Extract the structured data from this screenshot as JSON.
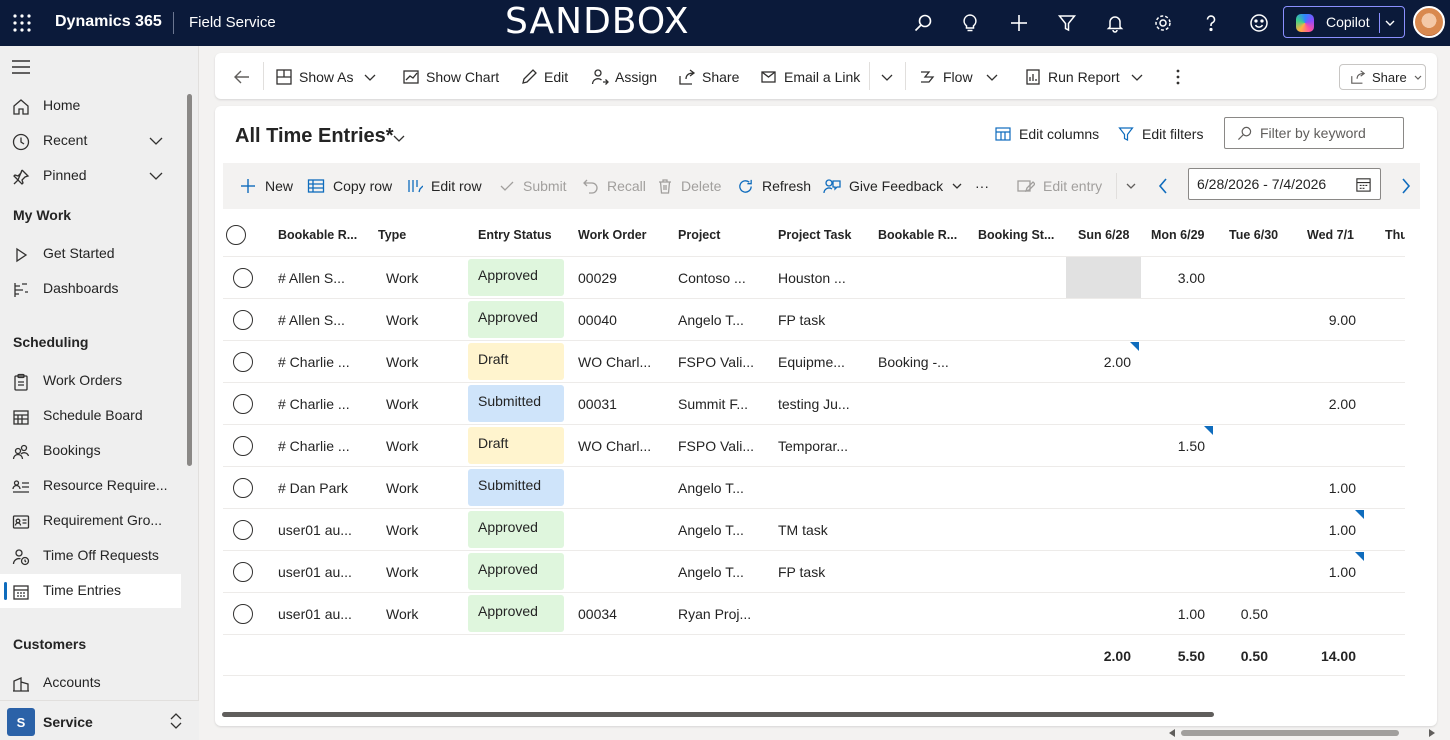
{
  "topbar": {
    "app_name": "Dynamics 365",
    "area_name": "Field Service",
    "environment_banner": "SANDBOX",
    "copilot_label": "Copilot",
    "icons": [
      "search-icon",
      "lightbulb-icon",
      "plus-icon",
      "filter-icon",
      "bell-icon",
      "gear-icon",
      "help-icon",
      "smiley-icon"
    ]
  },
  "sidebar": {
    "top_items": [
      {
        "label": "Home",
        "icon": "home-icon"
      },
      {
        "label": "Recent",
        "icon": "clock-icon"
      },
      {
        "label": "Pinned",
        "icon": "pin-icon"
      }
    ],
    "groups": [
      {
        "title": "My Work",
        "items": [
          {
            "label": "Get Started",
            "icon": "play-icon"
          },
          {
            "label": "Dashboards",
            "icon": "dashboard-icon"
          }
        ]
      },
      {
        "title": "Scheduling",
        "items": [
          {
            "label": "Work Orders",
            "icon": "clipboard-icon"
          },
          {
            "label": "Schedule Board",
            "icon": "calendar-grid-icon"
          },
          {
            "label": "Bookings",
            "icon": "people-icon"
          },
          {
            "label": "Resource Require...",
            "icon": "list-person-icon"
          },
          {
            "label": "Requirement Gro...",
            "icon": "id-card-icon"
          },
          {
            "label": "Time Off Requests",
            "icon": "person-clock-icon"
          },
          {
            "label": "Time Entries",
            "icon": "calendar-icon"
          }
        ]
      },
      {
        "title": "Customers",
        "items": [
          {
            "label": "Accounts",
            "icon": "building-icon"
          }
        ]
      }
    ],
    "area_switcher": {
      "badge": "S",
      "label": "Service"
    }
  },
  "commandbar": {
    "show_as": "Show As",
    "show_chart": "Show Chart",
    "edit": "Edit",
    "assign": "Assign",
    "share": "Share",
    "email_link": "Email a Link",
    "flow": "Flow",
    "run_report": "Run Report",
    "share_button": "Share"
  },
  "view": {
    "title": "All Time Entries*",
    "edit_columns": "Edit columns",
    "edit_filters": "Edit filters",
    "filter_placeholder": "Filter by keyword"
  },
  "subbar": {
    "new": "New",
    "copy_row": "Copy row",
    "edit_row": "Edit row",
    "submit": "Submit",
    "recall": "Recall",
    "delete": "Delete",
    "refresh": "Refresh",
    "give_feedback": "Give Feedback",
    "more": "···",
    "edit_entry": "Edit entry",
    "date_range": "6/28/2026 - 7/4/2026"
  },
  "grid": {
    "columns": [
      "Bookable R...",
      "Type",
      "Entry Status",
      "Work Order",
      "Project",
      "Project Task",
      "Bookable R...",
      "Booking St...",
      "Sun 6/28",
      "Mon 6/29",
      "Tue 6/30",
      "Wed 7/1",
      "Thu"
    ],
    "rows": [
      {
        "resource": "# Allen S...",
        "type": "Work",
        "status": "Approved",
        "work_order": "00029",
        "project": "Contoso ...",
        "task": "Houston ...",
        "bookable": "",
        "booking_status": "",
        "sun": "",
        "mon": "3.00",
        "tue": "",
        "wed": "",
        "sun_shaded": true
      },
      {
        "resource": "# Allen S...",
        "type": "Work",
        "status": "Approved",
        "work_order": "00040",
        "project": "Angelo T...",
        "task": "FP task",
        "bookable": "",
        "booking_status": "",
        "sun": "",
        "mon": "",
        "tue": "",
        "wed": "9.00"
      },
      {
        "resource": "# Charlie ...",
        "type": "Work",
        "status": "Draft",
        "work_order": "WO Charl...",
        "project": "FSPO Vali...",
        "task": "Equipme...",
        "bookable": "Booking -...",
        "booking_status": "",
        "sun": "2.00",
        "mon": "",
        "tue": "",
        "wed": "",
        "flag": "sun"
      },
      {
        "resource": "# Charlie ...",
        "type": "Work",
        "status": "Submitted",
        "work_order": "00031",
        "project": "Summit F...",
        "task": "testing Ju...",
        "bookable": "",
        "booking_status": "",
        "sun": "",
        "mon": "",
        "tue": "",
        "wed": "2.00"
      },
      {
        "resource": "# Charlie ...",
        "type": "Work",
        "status": "Draft",
        "work_order": "WO Charl...",
        "project": "FSPO Vali...",
        "task": "Temporar...",
        "bookable": "",
        "booking_status": "",
        "sun": "",
        "mon": "1.50",
        "tue": "",
        "wed": "",
        "flag": "mon"
      },
      {
        "resource": "# Dan Park",
        "type": "Work",
        "status": "Submitted",
        "work_order": "",
        "project": "Angelo T...",
        "task": "",
        "bookable": "",
        "booking_status": "",
        "sun": "",
        "mon": "",
        "tue": "",
        "wed": "1.00"
      },
      {
        "resource": "user01 au...",
        "type": "Work",
        "status": "Approved",
        "work_order": "",
        "project": "Angelo T...",
        "task": "TM task",
        "bookable": "",
        "booking_status": "",
        "sun": "",
        "mon": "",
        "tue": "",
        "wed": "1.00",
        "flag": "wed"
      },
      {
        "resource": "user01 au...",
        "type": "Work",
        "status": "Approved",
        "work_order": "",
        "project": "Angelo T...",
        "task": "FP task",
        "bookable": "",
        "booking_status": "",
        "sun": "",
        "mon": "",
        "tue": "",
        "wed": "1.00",
        "flag": "wed"
      },
      {
        "resource": "user01 au...",
        "type": "Work",
        "status": "Approved",
        "work_order": "00034",
        "project": "Ryan Proj...",
        "task": "",
        "bookable": "",
        "booking_status": "",
        "sun": "",
        "mon": "1.00",
        "tue": "0.50",
        "wed": ""
      }
    ],
    "totals": {
      "sun": "2.00",
      "mon": "5.50",
      "tue": "0.50",
      "wed": "14.00"
    }
  },
  "colors": {
    "topbar": "#0b1a3a",
    "accent": "#0f6cbd",
    "approved": "#dff6dd",
    "draft": "#fff4ce",
    "submitted": "#cfe4fa"
  }
}
